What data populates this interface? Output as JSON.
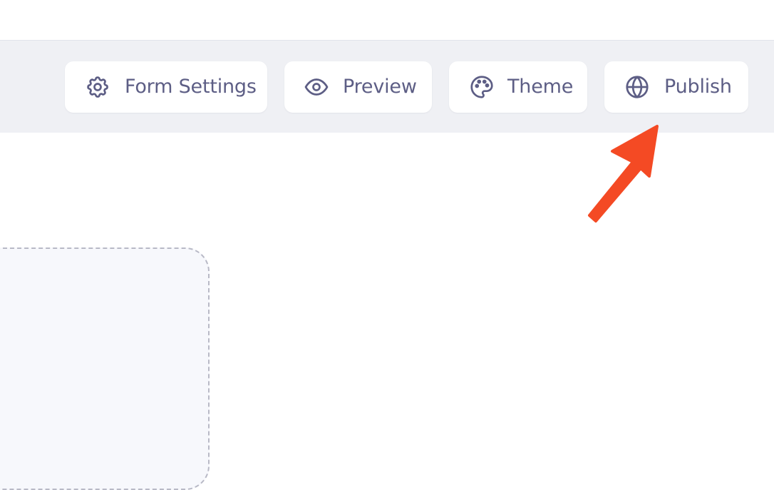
{
  "toolbar": {
    "form_settings": {
      "label": "Form Settings",
      "icon": "gear-icon"
    },
    "preview": {
      "label": "Preview",
      "icon": "eye-icon"
    },
    "theme": {
      "label": "Theme",
      "icon": "palette-icon"
    },
    "publish": {
      "label": "Publish",
      "icon": "globe-icon"
    }
  },
  "colors": {
    "toolbar_bg": "#eff0f4",
    "button_bg": "#ffffff",
    "button_text": "#5d5e85",
    "annotation_arrow": "#f44a24",
    "canvas_bg": "#f7f8fc",
    "canvas_border": "#b8b9c6"
  }
}
